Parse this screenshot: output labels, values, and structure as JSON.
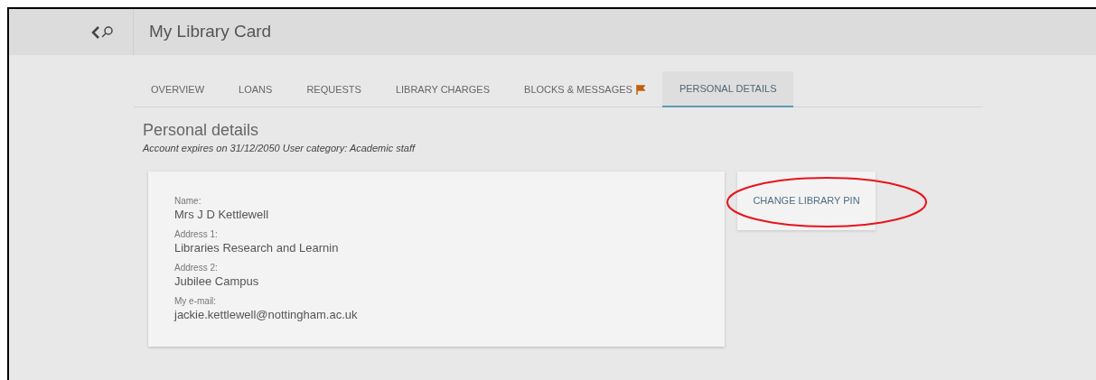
{
  "header": {
    "title": "My Library Card"
  },
  "tabs": [
    {
      "label": "OVERVIEW",
      "selected": false,
      "flagged": false
    },
    {
      "label": "LOANS",
      "selected": false,
      "flagged": false
    },
    {
      "label": "REQUESTS",
      "selected": false,
      "flagged": false
    },
    {
      "label": "LIBRARY CHARGES",
      "selected": false,
      "flagged": false
    },
    {
      "label": "BLOCKS & MESSAGES",
      "selected": false,
      "flagged": true
    },
    {
      "label": "PERSONAL DETAILS",
      "selected": true,
      "flagged": false
    }
  ],
  "section": {
    "heading": "Personal details",
    "subtitle": "Account expires on 31/12/2050 User category: Academic staff"
  },
  "details": [
    {
      "label": "Name:",
      "value": "Mrs J D Kettlewell"
    },
    {
      "label": "Address 1:",
      "value": "Libraries Research and Learnin"
    },
    {
      "label": "Address 2:",
      "value": "Jubilee Campus"
    },
    {
      "label": "My e-mail:",
      "value": "jackie.kettlewell@nottingham.ac.uk"
    }
  ],
  "change_pin": {
    "label": "CHANGE LIBRARY PIN",
    "circled": true
  }
}
